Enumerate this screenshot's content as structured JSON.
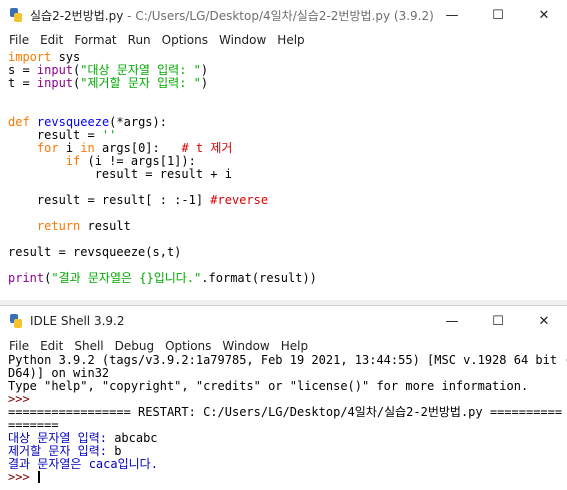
{
  "editor": {
    "title_file": "실습2-2번방법.py",
    "title_sep": " - ",
    "title_path": "C:/Users/LG/Desktop/4일차/실습2-2번방법.py (3.9.2)",
    "controls": {
      "minimize": "—",
      "maximize": "☐",
      "close": "✕"
    },
    "menu": [
      "File",
      "Edit",
      "Format",
      "Run",
      "Options",
      "Window",
      "Help"
    ],
    "code": {
      "l1_kw": "import",
      "l1_rest": " sys",
      "l2_a": "s = ",
      "l2_fn": "input",
      "l2_b": "(",
      "l2_str": "\"대상 문자열 입력: \"",
      "l2_c": ")",
      "l3_a": "t = ",
      "l3_fn": "input",
      "l3_b": "(",
      "l3_str": "\"제거할 문자 입력: \"",
      "l3_c": ")",
      "l4_kw": "def",
      "l4_sp": " ",
      "l4_name": "revsqueeze",
      "l4_rest": "(*args):",
      "l5_a": "    result = ",
      "l5_str": "''",
      "l6_a": "    ",
      "l6_kw1": "for",
      "l6_b": " i ",
      "l6_kw2": "in",
      "l6_c": " args[0]:   ",
      "l6_cm": "# t 제거",
      "l7_a": "        ",
      "l7_kw": "if",
      "l7_b": " (i != args[1]):",
      "l8": "            result = result + i",
      "l9_a": "    result = result[ : :-1] ",
      "l9_cm": "#reverse",
      "l10_a": "    ",
      "l10_kw": "return",
      "l10_b": " result",
      "l11": "result = revsqueeze(s,t)",
      "l12_fn": "print",
      "l12_b": "(",
      "l12_str": "\"결과 문자열은 {}입니다.\"",
      "l12_c": ".format(result))"
    }
  },
  "shell": {
    "title": "IDLE Shell 3.9.2",
    "controls": {
      "minimize": "—",
      "maximize": "☐",
      "close": "✕"
    },
    "menu": [
      "File",
      "Edit",
      "Shell",
      "Debug",
      "Options",
      "Window",
      "Help"
    ],
    "lines": {
      "banner1": "Python 3.9.2 (tags/v3.9.2:1a79785, Feb 19 2021, 13:44:55) [MSC v.1928 64 bit (AM",
      "banner2": "D64)] on win32",
      "banner3": "Type \"help\", \"copyright\", \"credits\" or \"license()\" for more information.",
      "prompt1": ">>> ",
      "restart1": "================= RESTART: C:/Users/LG/Desktop/4일차/실습2-2번방법.py ==========",
      "restart2": "=======",
      "in1_label": "대상 문자열 입력: ",
      "in1_value": "abcabc",
      "in2_label": "제거할 문자 입력: ",
      "in2_value": "b",
      "result": "결과 문자열은 caca입니다.",
      "prompt2": ">>> "
    }
  }
}
